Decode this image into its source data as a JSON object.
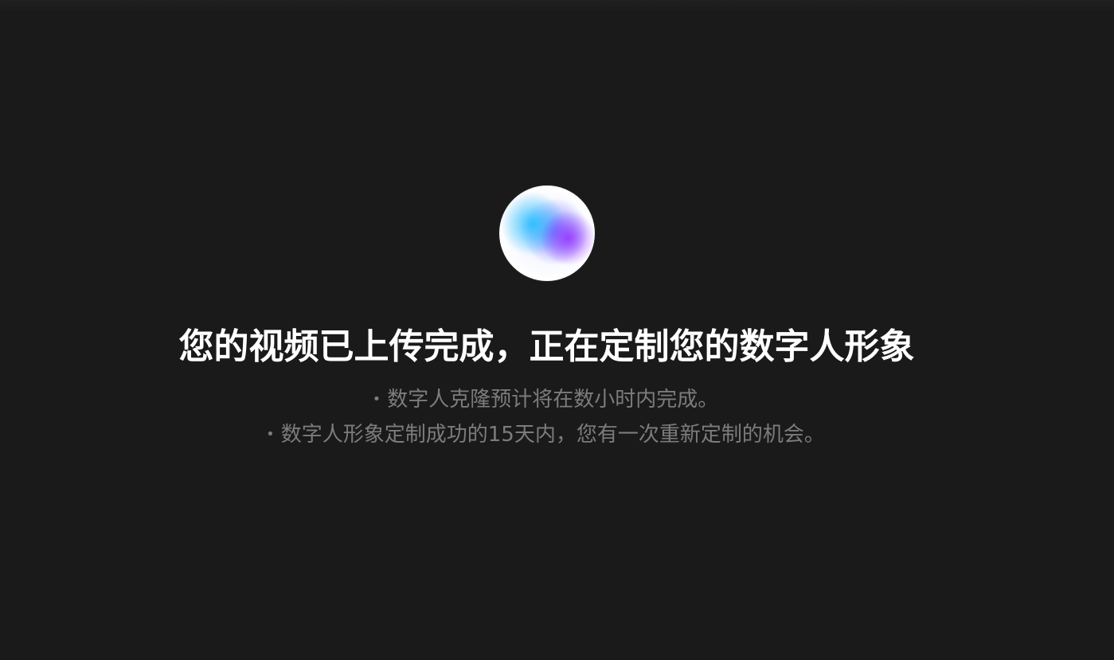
{
  "main": {
    "title": "您的视频已上传完成，正在定制您的数字人形象",
    "notes": [
      "数字人克隆预计将在数小时内完成。",
      "数字人形象定制成功的15天内，您有一次重新定制的机会。"
    ],
    "bullet": "•"
  },
  "icons": {
    "status_orb": "gradient-orb-icon"
  },
  "colors": {
    "background": "#1a1a1b",
    "title": "#ffffff",
    "notes": "#7c7c7e",
    "orb_blue": "#28beff",
    "orb_purple": "#963cff"
  }
}
